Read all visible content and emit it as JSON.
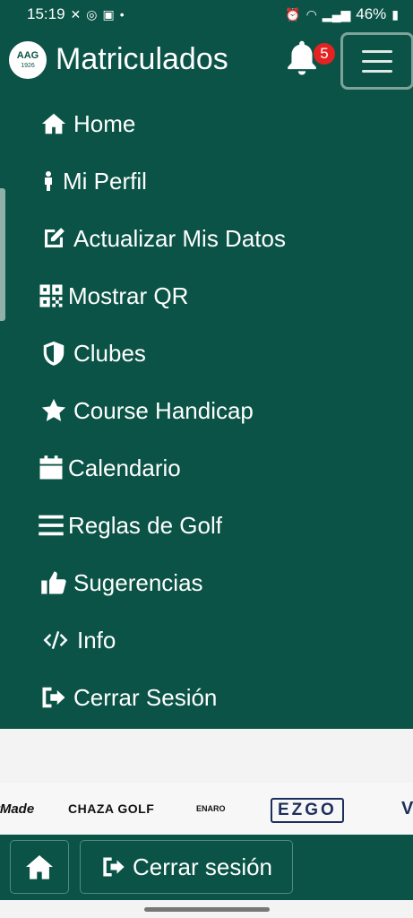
{
  "status_bar": {
    "time": "15:19",
    "battery": "46%"
  },
  "header": {
    "logo_text": "AAG",
    "logo_year": "1926",
    "title": "Matriculados",
    "notification_count": "5"
  },
  "menu": {
    "items": [
      {
        "label": "Home",
        "icon": "home-icon"
      },
      {
        "label": "Mi Perfil",
        "icon": "person-icon"
      },
      {
        "label": "Actualizar Mis Datos",
        "icon": "edit-icon"
      },
      {
        "label": "Mostrar QR",
        "icon": "qr-code-icon"
      },
      {
        "label": "Clubes",
        "icon": "shield-icon"
      },
      {
        "label": "Course Handicap",
        "icon": "star-icon"
      },
      {
        "label": "Calendario",
        "icon": "calendar-icon"
      },
      {
        "label": "Reglas de Golf",
        "icon": "list-icon"
      },
      {
        "label": "Sugerencias",
        "icon": "thumbs-up-icon"
      },
      {
        "label": "Info",
        "icon": "code-icon"
      },
      {
        "label": "Cerrar Sesión",
        "icon": "sign-out-icon"
      }
    ]
  },
  "sponsors": [
    "rMade",
    "CHAZA GOLF",
    "ENARO",
    "EZGO",
    "V"
  ],
  "bottom_bar": {
    "logout_label": "Cerrar sesión"
  },
  "colors": {
    "primary": "#0a5346",
    "badge": "#e52222"
  }
}
